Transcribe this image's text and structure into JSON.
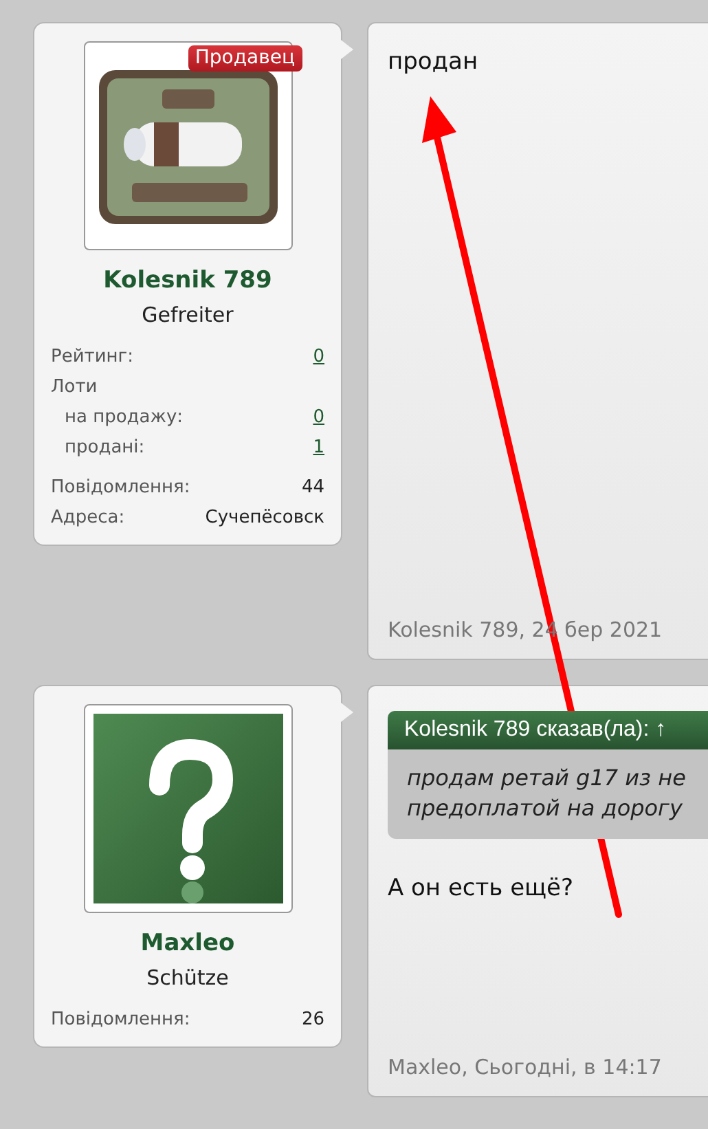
{
  "posts": [
    {
      "author": {
        "badge": "Продавец",
        "name": "Kolesnik 789",
        "title": "Gefreiter",
        "stat_groups": [
          [
            {
              "kind": "stat",
              "label": "Рейтинг:",
              "value": "0",
              "link": true
            },
            {
              "kind": "heading",
              "label": "Лоти"
            },
            {
              "kind": "sub",
              "label": "на продажу:",
              "value": "0",
              "link": true
            },
            {
              "kind": "sub",
              "label": "продані:",
              "value": "1",
              "link": true
            }
          ],
          [
            {
              "kind": "stat",
              "label": "Повідомлення:",
              "value": "44",
              "link": false
            },
            {
              "kind": "stat",
              "label": "Адреса:",
              "value": "Сучепёсовск",
              "link": false
            }
          ]
        ]
      },
      "message": {
        "body": "продан",
        "footer": "Kolesnik 789, 24 бер 2021"
      }
    },
    {
      "author": {
        "avatar": {
          "kind": "default"
        },
        "name": "Maxleo",
        "title": "Schütze",
        "stat_groups": [
          [
            {
              "kind": "stat",
              "label": "Повідомлення:",
              "value": "26",
              "link": false
            }
          ]
        ]
      },
      "message": {
        "quote": {
          "header": "Kolesnik 789 сказав(ла): ↑",
          "lines": [
            "продам ретай g17 из не",
            "предоплатой на дорогу"
          ]
        },
        "body": "А он есть ещё?",
        "footer": "Maxleo, Сьогодні, в 14:17"
      }
    }
  ]
}
